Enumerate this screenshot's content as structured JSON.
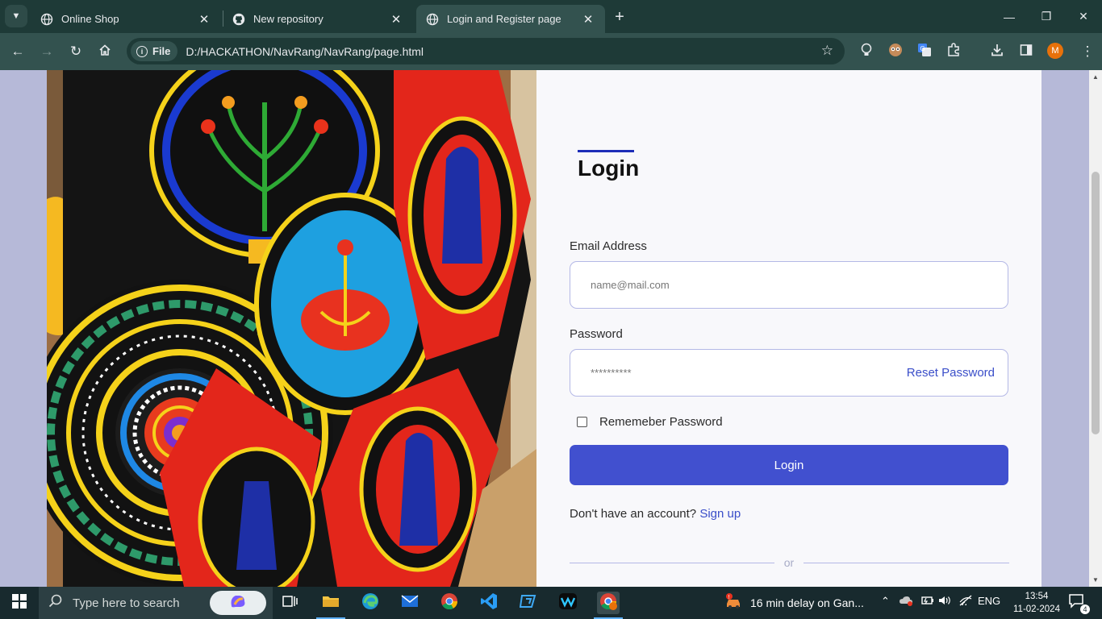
{
  "browser": {
    "tabs": [
      {
        "title": "Online Shop",
        "active": false
      },
      {
        "title": "New repository",
        "active": false
      },
      {
        "title": "Login and Register page",
        "active": true
      }
    ],
    "address_chip": "File",
    "url": "D:/HACKATHON/NavRang/NavRang/page.html",
    "profile_initial": "M"
  },
  "login": {
    "title": "Login",
    "email_label": "Email Address",
    "email_placeholder": "name@mail.com",
    "password_label": "Password",
    "password_value": "**********",
    "reset_label": "Reset Password",
    "remember_label": "Rememeber Password",
    "remember_checked": false,
    "submit_label": "Login",
    "signup_prompt": "Don't have an account?",
    "signup_link": "Sign up",
    "divider_text": "or"
  },
  "taskbar": {
    "search_placeholder": "Type here to search",
    "notice": "16 min delay on Gan...",
    "language": "ENG",
    "time": "13:54",
    "date": "11-02-2024",
    "notification_count": "4"
  },
  "colors": {
    "accent": "#4150cf",
    "link": "#3a4ec9",
    "page_background": "#b6b9d8",
    "browser_frame": "#1e3a37"
  }
}
